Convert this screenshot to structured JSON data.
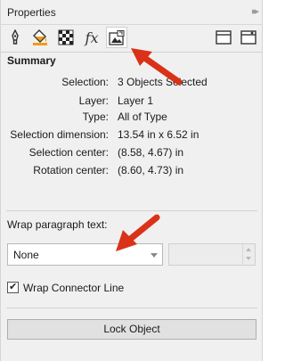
{
  "panel": {
    "title": "Properties",
    "collapse_glyph": "▸▸"
  },
  "toolbar": {
    "buttons": [
      {
        "name": "outline-pen-icon"
      },
      {
        "name": "fill-bucket-icon"
      },
      {
        "name": "transparency-checker-icon"
      },
      {
        "name": "effects-fx-icon",
        "label": "fx"
      },
      {
        "name": "summary-picture-icon",
        "active": true
      },
      {
        "name": "frame-icon"
      },
      {
        "name": "frame-settings-icon"
      }
    ]
  },
  "summary": {
    "title": "Summary",
    "rows": [
      {
        "label": "Selection:",
        "value": "3 Objects Selected"
      },
      {
        "label": "Layer:",
        "value": "Layer 1"
      },
      {
        "label": "Type:",
        "value": "All of Type"
      },
      {
        "label": "Selection dimension:",
        "value": "13.54 in x 6.52 in"
      },
      {
        "label": "Selection center:",
        "value": "(8.58, 4.67) in"
      },
      {
        "label": "Rotation center:",
        "value": "(8.60, 4.73) in"
      }
    ]
  },
  "wrap": {
    "label": "Wrap paragraph text:",
    "selected": "None",
    "stepper_value": ""
  },
  "connector": {
    "label": "Wrap Connector Line",
    "checked": true,
    "check_glyph": "✔"
  },
  "lock": {
    "label": "Lock Object"
  },
  "colors": {
    "annotation_arrow": "#d93218",
    "panel_bg": "#f0f0f0",
    "active_tab_bg": "#ffffff"
  }
}
